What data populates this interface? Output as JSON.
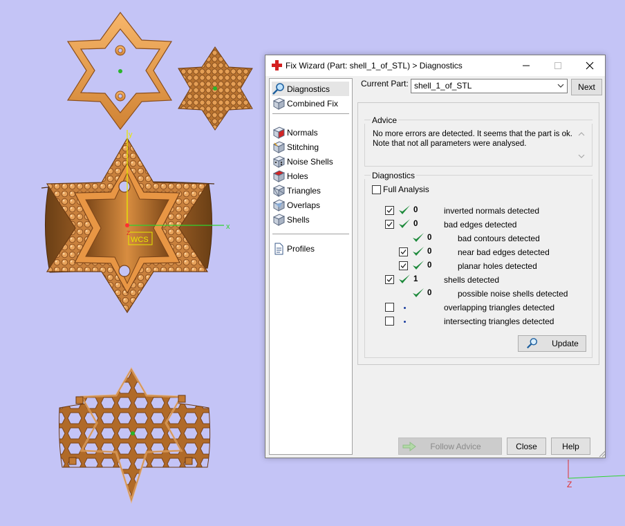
{
  "viewport": {
    "wcs_label": "WCS",
    "axis_x": "x",
    "axis_y": "y",
    "axis_z": "z",
    "axis_z2": "Z",
    "model_color": "#d8893c"
  },
  "dialog": {
    "title": "Fix Wizard (Part: shell_1_of_STL) > Diagnostics",
    "nav": {
      "top_items": [
        {
          "label": "Diagnostics",
          "icon": "magnifier-icon",
          "selected": true
        },
        {
          "label": "Combined Fix",
          "icon": "cube-icon"
        }
      ],
      "fix_items": [
        {
          "label": "Normals",
          "icon": "normals-cube-icon"
        },
        {
          "label": "Stitching",
          "icon": "stitching-cube-icon"
        },
        {
          "label": "Noise Shells",
          "icon": "noise-shells-cube-icon"
        },
        {
          "label": "Holes",
          "icon": "holes-cube-icon"
        },
        {
          "label": "Triangles",
          "icon": "triangles-cube-icon"
        },
        {
          "label": "Overlaps",
          "icon": "overlaps-cube-icon"
        },
        {
          "label": "Shells",
          "icon": "shells-cube-icon"
        }
      ],
      "bottom_items": [
        {
          "label": "Profiles",
          "icon": "document-icon"
        }
      ]
    },
    "current_part_label": "Current Part:",
    "current_part_value": "shell_1_of_STL",
    "next_label": "Next",
    "advice_title": "Advice",
    "advice_text_1": "No more errors are detected. It seems that the part is ok.",
    "advice_text_2": "Note that not all parameters were analysed.",
    "diagnostics_title": "Diagnostics",
    "full_analysis_label": "Full Analysis",
    "rows": [
      {
        "label": "inverted normals detected",
        "count": "0",
        "checkbox": true,
        "checked": true,
        "status": "ok",
        "indent": 0
      },
      {
        "label": "bad edges detected",
        "count": "0",
        "checkbox": true,
        "checked": true,
        "status": "ok",
        "indent": 0
      },
      {
        "label": "bad contours detected",
        "count": "0",
        "checkbox": false,
        "checked": false,
        "status": "ok",
        "indent": 1
      },
      {
        "label": "near bad edges detected",
        "count": "0",
        "checkbox": true,
        "checked": true,
        "status": "ok",
        "indent": 1
      },
      {
        "label": "planar holes detected",
        "count": "0",
        "checkbox": true,
        "checked": true,
        "status": "ok",
        "indent": 1
      },
      {
        "label": "shells detected",
        "count": "1",
        "checkbox": true,
        "checked": true,
        "status": "ok",
        "indent": 0
      },
      {
        "label": "possible noise shells detected",
        "count": "0",
        "checkbox": false,
        "checked": false,
        "status": "ok",
        "indent": 1
      },
      {
        "label": "overlapping triangles detected",
        "count": "",
        "checkbox": true,
        "checked": false,
        "status": "none",
        "indent": 0
      },
      {
        "label": "intersecting triangles detected",
        "count": "",
        "checkbox": true,
        "checked": false,
        "status": "none",
        "indent": 0
      }
    ],
    "update_label": "Update",
    "follow_advice_label": "Follow Advice",
    "close_label": "Close",
    "help_label": "Help"
  }
}
